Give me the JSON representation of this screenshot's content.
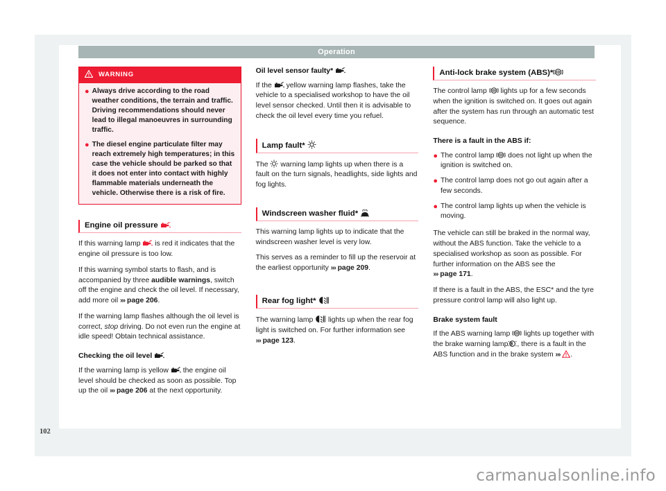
{
  "header": {
    "title": "Operation"
  },
  "page_number": "102",
  "watermark": "carmanualsonline.info",
  "colors": {
    "warning_red": "#ee1c32",
    "warning_bg": "#fdeef1",
    "header_band": "#a7b5b4",
    "rule_pink": "#f6a0ae",
    "page_frame": "#eef2f2"
  },
  "left_column": {
    "warning_box": {
      "label": "WARNING",
      "icon": "warning-triangle-icon",
      "items": [
        "Always drive according to the road weather conditions, the terrain and traffic. Driving recommendations should never lead to illegal manoeuvres in surrounding traffic.",
        "The diesel engine particulate filter may reach extremely high temperatures; in this case the vehicle should be parked so that it does not enter into contact with highly flammable materials underneath the vehicle. Otherwise there is a risk of fire."
      ]
    },
    "section": {
      "heading": "Engine oil pressure",
      "heading_icon": "oil-can-icon-red",
      "paragraphs": [
        "If this warning lamp   is red it indicates that the engine oil pressure is too low.",
        "If this warning symbol starts to flash, and is accompanied by three audible warnings, switch off the engine and check the oil level. If necessary, add more oil ››› page 206.",
        "If the warning lamp flashes although the oil level is correct, stop driving. Do not even run the engine at idle speed! Obtain technical assistance."
      ],
      "sub_heading": "Checking the oil level",
      "sub_heading_icon": "oil-can-icon",
      "sub_paragraph": "If the warning lamp is yellow   the engine oil level should be checked as soon as possible. Top up the oil ››› page 206 at the next opportunity."
    },
    "text_fragments": {
      "p1_a": "If this warning lamp",
      "p1_b": "is red it indicates that the engine oil pressure is too low.",
      "p2_a": "If this warning symbol starts to flash, and is accompanied by three ",
      "p2_bold": "audible warnings",
      "p2_b": ", switch off the engine and check the oil level. If necessary, add more oil",
      "p2_ref": "page 206",
      "p2_end": ".",
      "p3_a": "If the warning lamp flashes although the oil level is correct, ",
      "p3_italic": "stop",
      "p3_b": " driving. Do not even run the engine at idle speed! Obtain technical assistance.",
      "p4_a": "If the warning lamp is yellow",
      "p4_b": "the engine oil level should be checked as soon as possible. Top up the oil",
      "p4_ref": "page 206",
      "p4_end": "at the next opportunity."
    }
  },
  "middle_column": {
    "oil_sensor": {
      "sub_heading": "Oil level sensor faulty*",
      "sub_heading_icon": "oil-can-icon",
      "text_a": "If the",
      "text_b": "yellow warning lamp flashes, take the vehicle to a specialised workshop to have the oil level sensor checked. Until then it is advisable to check the oil level every time you refuel."
    },
    "lamp_fault": {
      "heading": "Lamp fault*",
      "heading_icon": "bulb-fault-icon",
      "text_a": "The",
      "text_b": "warning lamp lights up when there is a fault on the turn signals, headlights, side lights and fog lights."
    },
    "washer_fluid": {
      "heading": "Windscreen washer fluid*",
      "heading_icon": "windscreen-washer-icon",
      "paragraph_1": "This warning lamp lights up to indicate that the windscreen washer level is very low.",
      "paragraph_2a": "This serves as a reminder to fill up the reservoir at the earliest opportunity",
      "paragraph_2_ref": "page 209",
      "paragraph_2_end": "."
    },
    "rear_fog": {
      "heading": "Rear fog light*",
      "heading_icon": "rear-fog-light-icon",
      "text_a": "The warning lamp",
      "text_b": "lights up when the rear fog light is switched on. For further information see",
      "ref": "page 123",
      "text_end": "."
    }
  },
  "right_column": {
    "abs": {
      "heading": "Anti-lock brake system (ABS)*",
      "heading_icon": "abs-lamp-icon",
      "intro_a": "The control lamp",
      "intro_b": "lights up for a few seconds when the ignition is switched on. It goes out again after the system has run through an automatic test sequence.",
      "fault_heading": "There is a fault in the ABS if:",
      "bullets": [
        {
          "text_a": "The control lamp",
          "icon": "abs-lamp-icon",
          "text_b": "does not light up when the ignition is switched on."
        },
        {
          "text_a": "The control lamp does not go out again after a few seconds.",
          "icon": "",
          "text_b": ""
        },
        {
          "text_a": "The control lamp lights up when the vehicle is moving.",
          "icon": "",
          "text_b": ""
        }
      ],
      "para_after_a": "The vehicle can still be braked in the normal way, without the ABS function. Take the vehicle to a specialised workshop as soon as possible. For further information on the ABS see the",
      "para_after_ref": "page 171",
      "para_after_end": ".",
      "para_esc": "If there is a fault in the ABS, the ESC* and the tyre pressure control lamp will also light up."
    },
    "brake_fault": {
      "heading": "Brake system fault",
      "text_a": "If the ABS warning lamp",
      "text_b": "lights up together with the brake warning lamp",
      "text_c": ", there is a fault in the ABS function and in the brake system",
      "ref_arrows": "›››",
      "ref_icon": "warning-triangle-icon-red",
      "text_end": "."
    }
  }
}
